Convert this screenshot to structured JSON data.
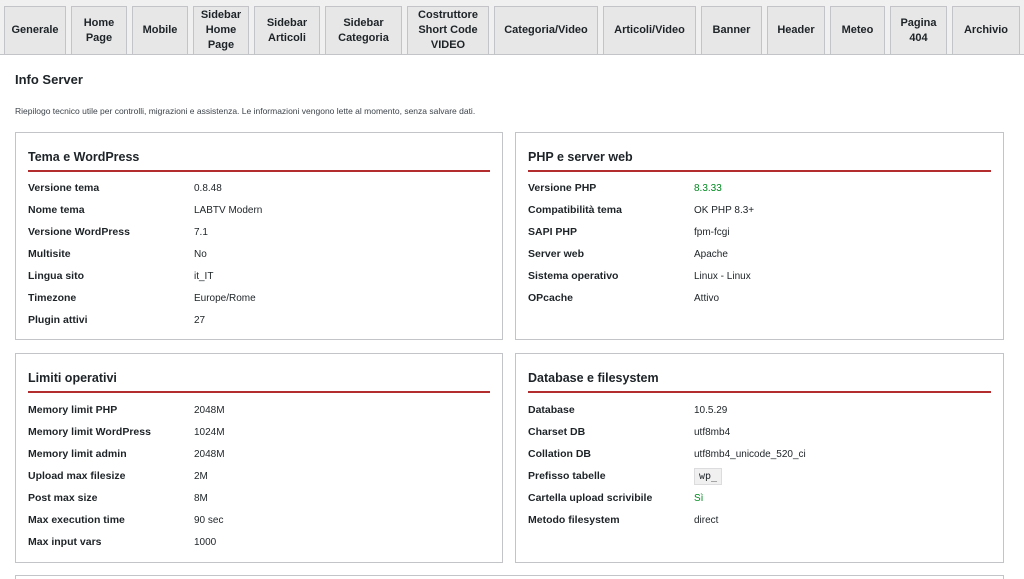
{
  "tabs": [
    {
      "label": "Generale"
    },
    {
      "label": "Home\nPage"
    },
    {
      "label": "Mobile"
    },
    {
      "label": "Sidebar\nHome\nPage"
    },
    {
      "label": "Sidebar\nArticoli"
    },
    {
      "label": "Sidebar\nCategoria"
    },
    {
      "label": "Costruttore\nShort Code\nVIDEO"
    },
    {
      "label": "Categoria/Video"
    },
    {
      "label": "Articoli/Video"
    },
    {
      "label": "Banner"
    },
    {
      "label": "Header"
    },
    {
      "label": "Meteo"
    },
    {
      "label": "Pagina\n404"
    },
    {
      "label": "Archivio"
    }
  ],
  "page": {
    "title": "Info Server",
    "subtitle": "Riepilogo tecnico utile per controlli, migrazioni e assistenza. Le informazioni vengono lette al momento, senza salvare dati."
  },
  "cards": {
    "theme": {
      "title": "Tema e WordPress",
      "rows": [
        {
          "k": "Versione tema",
          "v": "0.8.48"
        },
        {
          "k": "Nome tema",
          "v": "LABTV Modern"
        },
        {
          "k": "Versione WordPress",
          "v": "7.1"
        },
        {
          "k": "Multisite",
          "v": "No"
        },
        {
          "k": "Lingua sito",
          "v": "it_IT"
        },
        {
          "k": "Timezone",
          "v": "Europe/Rome"
        },
        {
          "k": "Plugin attivi",
          "v": "27"
        }
      ]
    },
    "php": {
      "title": "PHP e server web",
      "rows": [
        {
          "k": "Versione PHP",
          "v": "8.3.33"
        },
        {
          "k": "Compatibilità tema",
          "v": "OK PHP 8.3+"
        },
        {
          "k": "SAPI PHP",
          "v": "fpm-fcgi"
        },
        {
          "k": "Server web",
          "v": "Apache"
        },
        {
          "k": "Sistema operativo",
          "v": "Linux - Linux"
        },
        {
          "k": "OPcache",
          "v": "Attivo"
        }
      ]
    },
    "limits": {
      "title": "Limiti operativi",
      "rows": [
        {
          "k": "Memory limit PHP",
          "v": "2048M"
        },
        {
          "k": "Memory limit WordPress",
          "v": "1024M"
        },
        {
          "k": "Memory limit admin",
          "v": "2048M"
        },
        {
          "k": "Upload max filesize",
          "v": "2M"
        },
        {
          "k": "Post max size",
          "v": "8M"
        },
        {
          "k": "Max execution time",
          "v": "90 sec"
        },
        {
          "k": "Max input vars",
          "v": "1000"
        }
      ]
    },
    "db": {
      "title": "Database e filesystem",
      "rows": [
        {
          "k": "Database",
          "v": "10.5.29"
        },
        {
          "k": "Charset DB",
          "v": "utf8mb4"
        },
        {
          "k": "Collation DB",
          "v": "utf8mb4_unicode_520_ci"
        },
        {
          "k": "Prefisso tabelle",
          "v": "wp_"
        },
        {
          "k": "Cartella upload scrivibile",
          "v": "Sì"
        },
        {
          "k": "Metodo filesystem",
          "v": "direct"
        }
      ]
    }
  },
  "colors": {
    "accent_rule": "#b32d2e",
    "ok_value": "#008a20"
  }
}
